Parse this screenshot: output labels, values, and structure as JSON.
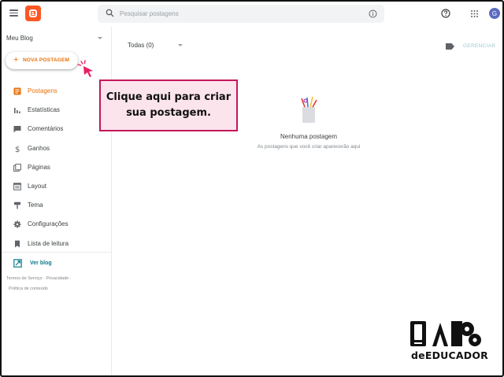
{
  "header": {
    "search_placeholder": "Pesquisar postagens",
    "avatar_letter": "G"
  },
  "sidebar": {
    "blog_name": "Meu Blog",
    "new_post_label": "NOVA POSTAGEM",
    "items": [
      {
        "label": "Postagens",
        "icon": "posts-icon",
        "active": true
      },
      {
        "label": "Estatísticas",
        "icon": "stats-icon",
        "active": false
      },
      {
        "label": "Comentários",
        "icon": "comments-icon",
        "active": false
      },
      {
        "label": "Ganhos",
        "icon": "dollar-icon",
        "active": false
      },
      {
        "label": "Páginas",
        "icon": "pages-icon",
        "active": false
      },
      {
        "label": "Layout",
        "icon": "layout-icon",
        "active": false
      },
      {
        "label": "Tema",
        "icon": "theme-icon",
        "active": false
      },
      {
        "label": "Configurações",
        "icon": "gear-icon",
        "active": false
      },
      {
        "label": "Lista de leitura",
        "icon": "bookmark-icon",
        "active": false
      }
    ],
    "view_blog_label": "Ver blog",
    "footer": {
      "terms": "Termos de Serviço",
      "privacy": "Privacidade",
      "content_policy": "Política de conteúdo"
    }
  },
  "main": {
    "filter_label": "Todas (0)",
    "manage_label": "GERENCIAR",
    "empty_title": "Nenhuma postagem",
    "empty_subtitle": "As postagens que você criar aparecerão aqui"
  },
  "callout": {
    "line1": "Clique aqui para criar",
    "line2": "sua postagem."
  },
  "brand": {
    "word": "deEDUCADOR"
  },
  "colors": {
    "accent": "#e8710a",
    "blogger_logo": "#ff5722",
    "callout_border": "#c2185b",
    "callout_bg": "#fce4ec"
  }
}
